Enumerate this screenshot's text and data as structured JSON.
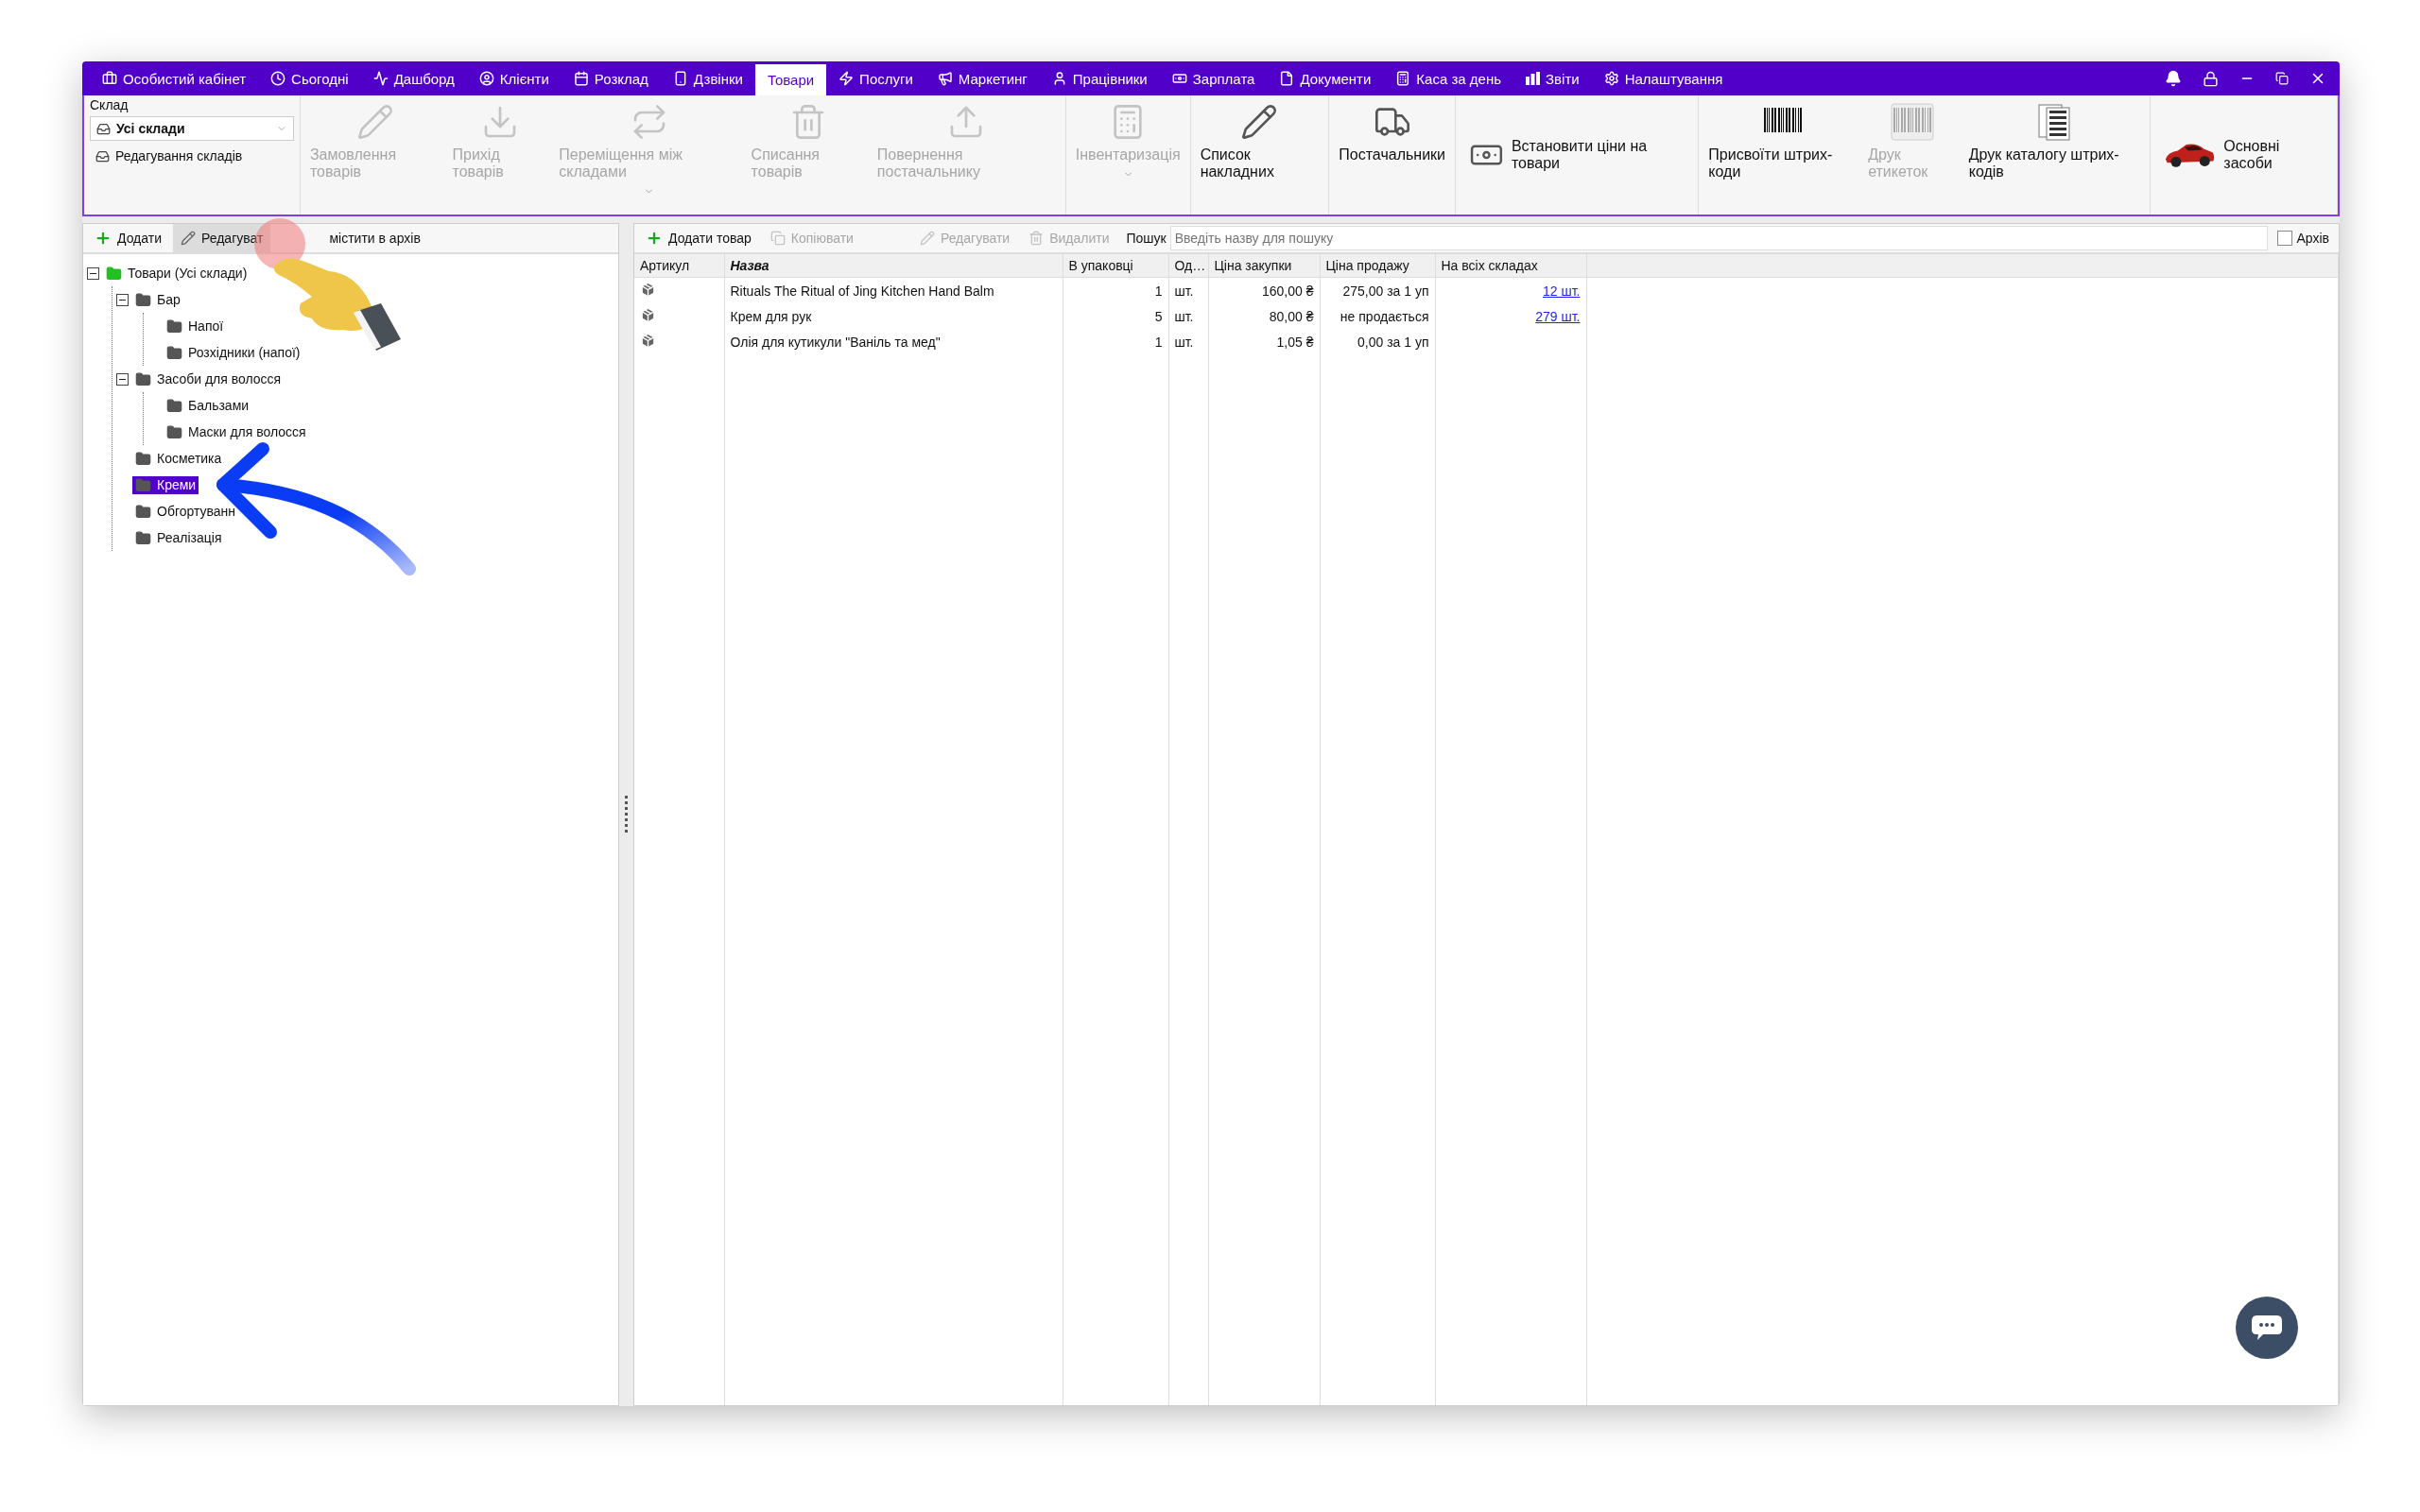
{
  "nav": {
    "tabs": [
      {
        "label": "Особистий кабінет",
        "selected": false
      },
      {
        "label": "Сьогодні",
        "selected": false
      },
      {
        "label": "Дашборд",
        "selected": false
      },
      {
        "label": "Клієнти",
        "selected": false
      },
      {
        "label": "Розклад",
        "selected": false
      },
      {
        "label": "Дзвінки",
        "selected": false
      },
      {
        "label": "Товари",
        "selected": true
      },
      {
        "label": "Послуги",
        "selected": false
      },
      {
        "label": "Маркетинг",
        "selected": false
      },
      {
        "label": "Працівники",
        "selected": false
      },
      {
        "label": "Зарплата",
        "selected": false
      },
      {
        "label": "Документи",
        "selected": false
      },
      {
        "label": "Каса за день",
        "selected": false
      },
      {
        "label": "Звіти",
        "selected": false
      },
      {
        "label": "Налаштування",
        "selected": false
      }
    ]
  },
  "ribbon": {
    "warehouse": {
      "label": "Склад",
      "value": "Усі склади",
      "edit": "Редагування складів"
    },
    "groups": [
      [
        {
          "label": "Замовлення\nтоварів",
          "disabled": true,
          "kind": "tall"
        },
        {
          "label": "Прихід\nтоварів",
          "disabled": true,
          "kind": "tall"
        },
        {
          "label": "Переміщення\nміж складами",
          "disabled": true,
          "dropdown": true,
          "kind": "tall"
        },
        {
          "label": "Списання\nтоварів",
          "disabled": true,
          "kind": "tall"
        },
        {
          "label": "Повернення\nпостачальнику",
          "disabled": true,
          "kind": "tall"
        }
      ],
      [
        {
          "label": "Інвентаризація",
          "disabled": true,
          "dropdown": true,
          "kind": "tall"
        }
      ],
      [
        {
          "label": "Список\nнакладних",
          "disabled": false,
          "kind": "tall"
        }
      ],
      [
        {
          "label": "Постачальники",
          "disabled": false,
          "kind": "tall"
        }
      ],
      [
        {
          "label": "Встановити\nціни на товари",
          "disabled": false,
          "kind": "wide"
        }
      ],
      [
        {
          "label": "Присвоїти штрих-\nкоди",
          "disabled": false,
          "kind": "tall"
        },
        {
          "label": "Друк\nетикеток",
          "disabled": true,
          "kind": "tall"
        },
        {
          "label": "Друк каталогу\nштрих-кодів",
          "disabled": false,
          "kind": "tall"
        }
      ],
      [
        {
          "label": "Основні\nзасоби",
          "disabled": false,
          "kind": "wide"
        }
      ]
    ]
  },
  "tree_panel": {
    "toolbar": [
      {
        "label": "Додати",
        "highlighted": false
      },
      {
        "label": "Редагуват",
        "highlighted": true
      },
      {
        "label": "містити в архів",
        "highlighted": false
      }
    ],
    "tree": {
      "label": "Товари (Усі склади)",
      "expanded": true,
      "selected": false,
      "children": [
        {
          "label": "Бар",
          "expanded": true,
          "selected": false,
          "children": [
            {
              "label": "Напої",
              "selected": false
            },
            {
              "label": "Розхідники (напої)",
              "selected": false
            }
          ]
        },
        {
          "label": "Засоби для волосся",
          "expanded": true,
          "selected": false,
          "children": [
            {
              "label": "Бальзами",
              "selected": false
            },
            {
              "label": "Маски для волосся",
              "selected": false
            }
          ]
        },
        {
          "label": "Косметика",
          "selected": false
        },
        {
          "label": "Креми",
          "selected": true
        },
        {
          "label": "Обгортуванн",
          "selected": false
        },
        {
          "label": "Реалізація",
          "selected": false
        }
      ]
    }
  },
  "products": {
    "toolbar": [
      {
        "label": "Додати товар",
        "disabled": false
      },
      {
        "label": "Копіювати",
        "disabled": true
      },
      {
        "label": "Редагувати",
        "disabled": true
      },
      {
        "label": "Видалити",
        "disabled": true
      }
    ],
    "search": {
      "label": "Пошук",
      "placeholder": "Введіть назву для пошуку"
    },
    "archive": {
      "label": "Архів",
      "checked": false
    },
    "table": {
      "columns": [
        {
          "label": "Артикул",
          "sorted": false
        },
        {
          "label": "Назва",
          "sorted": true
        },
        {
          "label": "В упаковці",
          "sorted": false
        },
        {
          "label": "Од…",
          "sorted": false
        },
        {
          "label": "Ціна закупки",
          "sorted": false
        },
        {
          "label": "Ціна продажу",
          "sorted": false
        },
        {
          "label": "На всіх складах",
          "sorted": false
        }
      ],
      "rows": [
        {
          "name": "Rituals The Ritual of Jing Kitchen Hand Balm",
          "pack": "1",
          "unit": "шт.",
          "purchase": "160,00 ₴",
          "sale": "275,00 за 1 уп",
          "stock": "12 шт."
        },
        {
          "name": "Крем для рук",
          "pack": "5",
          "unit": "шт.",
          "purchase": "80,00 ₴",
          "sale": "не продається",
          "stock": "279 шт."
        },
        {
          "name": "Олія для кутикули \"Ваніль та мед\"",
          "pack": "1",
          "unit": "шт.",
          "purchase": "1,05 ₴",
          "sale": "0,00 за 1 уп"
        }
      ]
    }
  }
}
